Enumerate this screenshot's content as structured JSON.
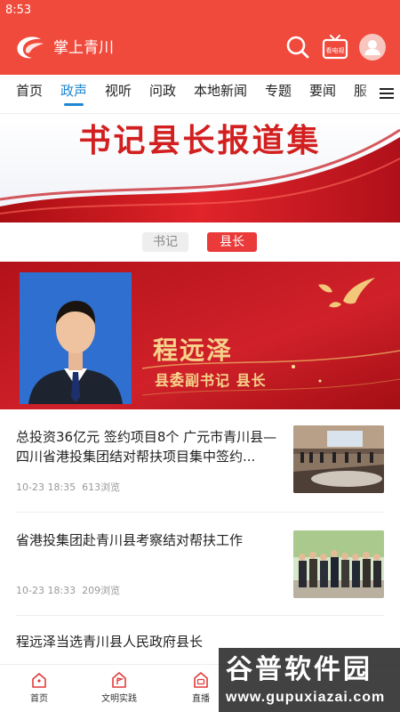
{
  "status_bar": {
    "time": "8:53"
  },
  "header": {
    "app_title": "掌上青川",
    "tv_badge": "看电视",
    "brand_color": "#f04a3c"
  },
  "nav": {
    "tabs": [
      {
        "label": "首页",
        "active": false
      },
      {
        "label": "政声",
        "active": true
      },
      {
        "label": "视听",
        "active": false
      },
      {
        "label": "问政",
        "active": false
      },
      {
        "label": "本地新闻",
        "active": false
      },
      {
        "label": "专题",
        "active": false
      },
      {
        "label": "要闻",
        "active": false
      },
      {
        "label": "服",
        "active": false
      }
    ],
    "active_color": "#1f86d1"
  },
  "banner": {
    "title": "书记县长报道集"
  },
  "segment": {
    "options": [
      "书记",
      "县长"
    ],
    "selected": "县长"
  },
  "profile": {
    "name": "程远泽",
    "role": "县委副书记 县长"
  },
  "news": [
    {
      "title": "总投资36亿元 签约项目8个 广元市青川县—四川省港投集团结对帮扶项目集中签约...",
      "time": "10-23 18:35",
      "views": "613浏览"
    },
    {
      "title": "省港投集团赴青川县考察结对帮扶工作",
      "time": "10-23 18:33",
      "views": "209浏览"
    },
    {
      "title": "程远泽当选青川县人民政府县长",
      "time": "",
      "views": ""
    }
  ],
  "bottom_nav": [
    {
      "label": "首页",
      "icon": "home-icon"
    },
    {
      "label": "文明实践",
      "icon": "flag-icon"
    },
    {
      "label": "直播",
      "icon": "live-icon"
    }
  ],
  "watermark": {
    "title": "谷普软件园",
    "url": "www.gupuxiazai.com"
  }
}
